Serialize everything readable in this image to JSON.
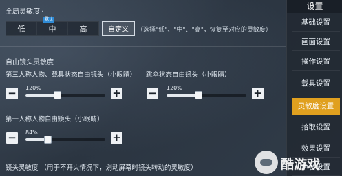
{
  "global_sensitivity": {
    "title": "全局灵敏度",
    "presets": [
      {
        "label": "低"
      },
      {
        "label": "中",
        "tag": "默认"
      },
      {
        "label": "高"
      }
    ],
    "custom_label": "自定义",
    "hint": "（选择\"低\"、\"中\"、\"高\"，恢复至对应的灵敏度）"
  },
  "free_look": {
    "title": "自由镜头灵敏度",
    "sliders": [
      {
        "label": "第三人称人物、载具状态自由镜头（小眼睛）",
        "value_text": "120%",
        "value": 1.2,
        "level": 0.4
      },
      {
        "label": "跳伞状态自由镜头（小眼睛）",
        "value_text": "120%",
        "value": 1.2,
        "level": 0.4
      },
      {
        "label": "第一人称人物自由镜头（小眼睛）",
        "value_text": "84%",
        "value": 0.84,
        "level": 0.28
      }
    ]
  },
  "camera_sensitivity": {
    "text": "镜头灵敏度  （用于不开火情况下，划动屏幕时镜头转动的灵敏度）"
  },
  "sidebar": {
    "title": "设置",
    "items": [
      {
        "label": "基础设置",
        "active": false
      },
      {
        "label": "画面设置",
        "active": false
      },
      {
        "label": "操作设置",
        "active": false
      },
      {
        "label": "载具设置",
        "active": false
      },
      {
        "label": "灵敏度设置",
        "active": true
      },
      {
        "label": "拾取设置",
        "active": false
      },
      {
        "label": "效果设置",
        "active": false
      },
      {
        "label": "声音设置",
        "active": false
      }
    ]
  },
  "watermark": {
    "text": "酷游戏"
  },
  "colors": {
    "accent": "#e0a01f",
    "active_tag": "#2f8bd6"
  },
  "icons": {
    "minus": "−",
    "plus": "+"
  }
}
